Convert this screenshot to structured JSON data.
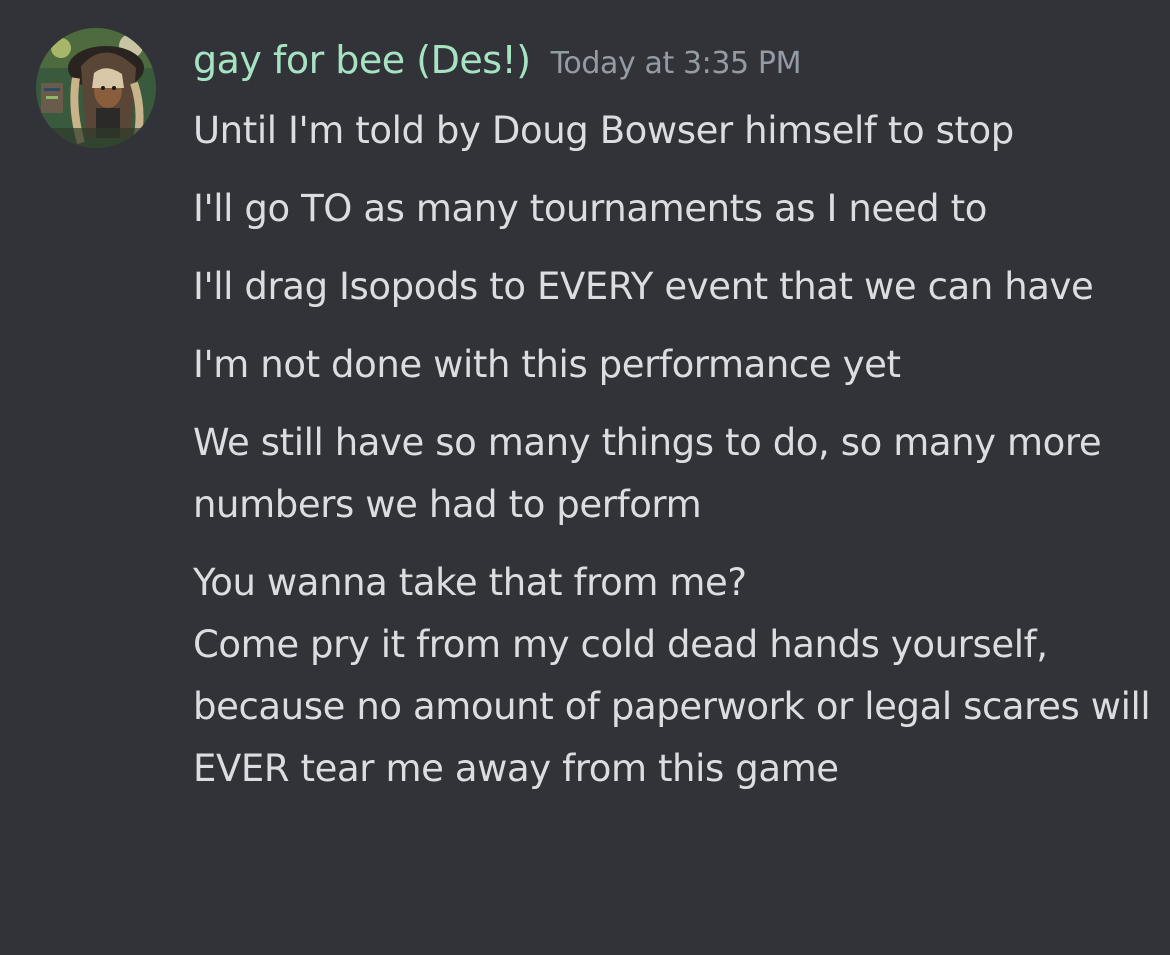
{
  "message": {
    "author": "gay for bee (Des!)",
    "timestamp": "Today at 3:35 PM",
    "avatar_icon": "user-avatar",
    "colors": {
      "background": "#313338",
      "username": "#a6e3c2",
      "timestamp": "#949ba4",
      "text": "#dbdee1"
    },
    "lines": [
      "Until I'm told by Doug Bowser himself to stop",
      "I'll go TO as many tournaments as I need to",
      "I'll drag Isopods to EVERY event that we can have",
      "I'm not done with this performance yet",
      "We still have so many things to do, so many more numbers we had to perform",
      "You wanna take that from me?",
      "Come pry it from my cold dead hands yourself, because no amount of paperwork or legal scares will EVER tear me away from this game"
    ]
  }
}
